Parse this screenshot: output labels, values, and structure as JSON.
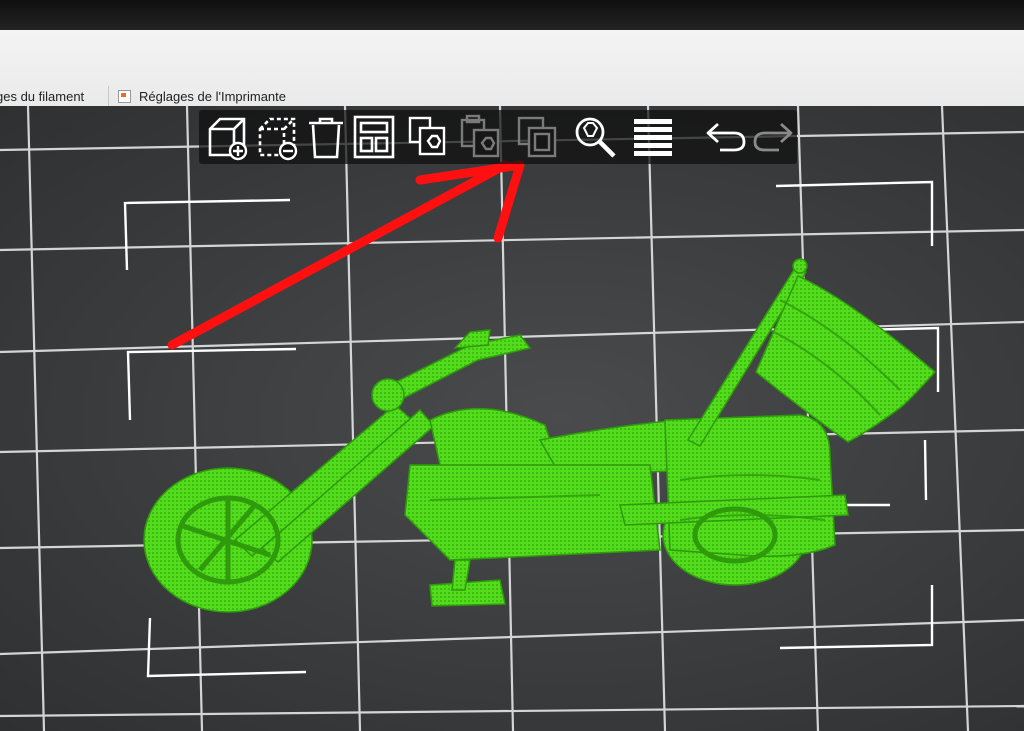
{
  "tabs": {
    "filament_label": "ges du filament",
    "printer_label": "Réglages de l'Imprimante"
  },
  "toolbar": {
    "buttons": [
      {
        "name": "add-object",
        "icon": "cube-plus-icon",
        "enabled": true
      },
      {
        "name": "remove-object",
        "icon": "cube-minus-icon",
        "enabled": true
      },
      {
        "name": "delete-all",
        "icon": "trash-icon",
        "enabled": true
      },
      {
        "name": "arrange",
        "icon": "arrange-grid-icon",
        "enabled": true
      },
      {
        "name": "copy",
        "icon": "copy-icon",
        "enabled": true
      },
      {
        "name": "paste",
        "icon": "paste-icon",
        "enabled": false
      },
      {
        "name": "layers-editing",
        "icon": "layers-icon",
        "enabled": false
      },
      {
        "name": "search",
        "icon": "search-icon",
        "enabled": true
      },
      {
        "name": "layers",
        "icon": "layers-stack-icon",
        "enabled": true
      },
      {
        "name": "undo",
        "icon": "undo-icon",
        "enabled": true
      },
      {
        "name": "redo",
        "icon": "redo-icon",
        "enabled": false
      }
    ]
  },
  "scene": {
    "object": "motorcycle-model",
    "object_color": "#4fd81a",
    "bed_color": "#3e3f41",
    "grid_color": "#e6e6e6",
    "annotation": "red-arrow",
    "annotation_color": "#ff1010"
  }
}
